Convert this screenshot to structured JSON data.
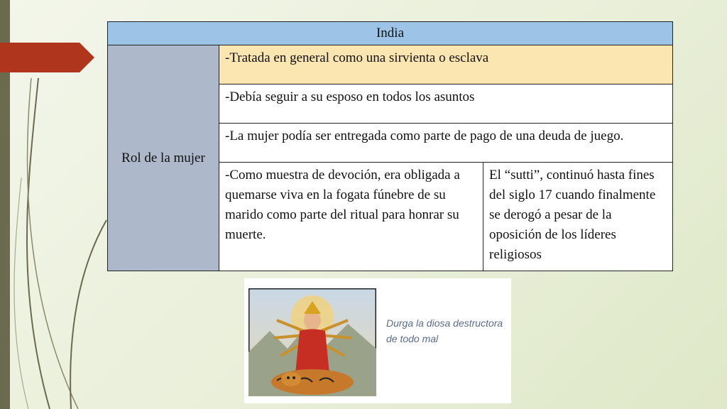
{
  "slide": {
    "table": {
      "header": "India",
      "row_label": "Rol de la mujer",
      "rows": [
        "-Tratada en general como una sirvienta o esclava",
        "-Debía seguir a su esposo en todos los asuntos",
        "-La mujer podía ser entregada como parte de pago de una deuda de juego."
      ],
      "bottom_left": "-Como muestra de devoción, era obligada a quemarse viva en la fogata fúnebre de su marido como parte del ritual para honrar su muerte.",
      "bottom_right": "El “sutti”, continuó hasta fines del siglo 17 cuando finalmente se derogó a pesar de la oposición de los líderes religiosos"
    },
    "image_caption": "Durga la diosa destructora de todo mal",
    "colors": {
      "header_blue": "#9dc3e6",
      "label_gray_blue": "#adb9ca",
      "highlight_row": "#fbe5b0",
      "accent_red": "#b0351d",
      "side_bar": "#6b6a4e"
    }
  }
}
